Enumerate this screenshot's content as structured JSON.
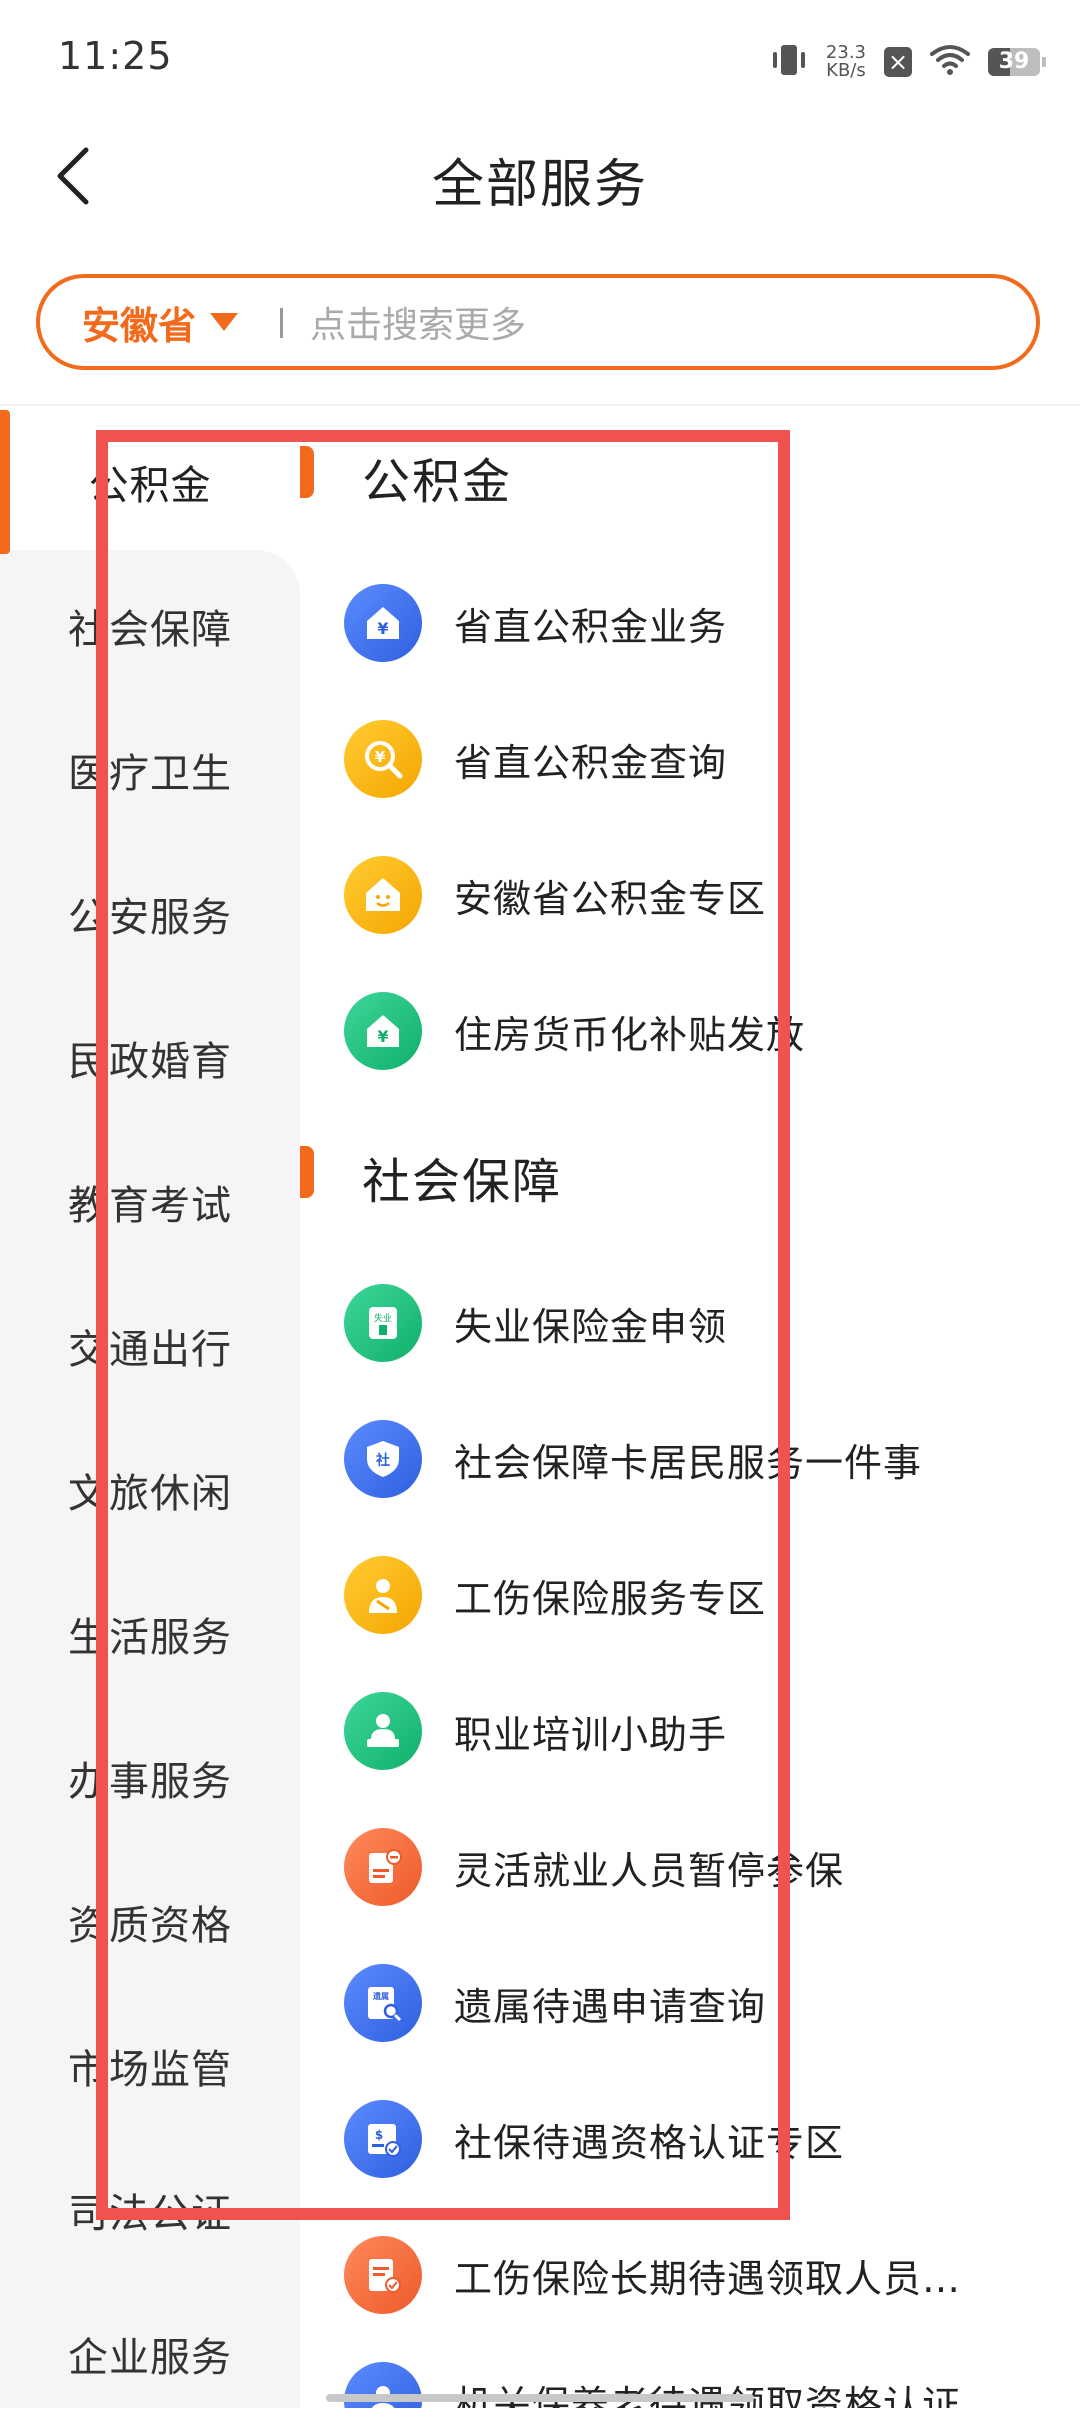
{
  "status_bar": {
    "time": "11:25",
    "net_speed_value": "23.3",
    "net_speed_unit": "KB/s",
    "battery": "39",
    "icons": [
      "vibrate-icon",
      "close-box-icon",
      "wifi-icon",
      "battery-icon"
    ]
  },
  "header": {
    "title": "全部服务"
  },
  "search": {
    "province": "安徽省",
    "placeholder": "点击搜索更多"
  },
  "sidebar": {
    "items": [
      {
        "label": "公积金",
        "active": true
      },
      {
        "label": "社会保障"
      },
      {
        "label": "医疗卫生"
      },
      {
        "label": "公安服务"
      },
      {
        "label": "民政婚育"
      },
      {
        "label": "教育考试"
      },
      {
        "label": "交通出行"
      },
      {
        "label": "文旅休闲"
      },
      {
        "label": "生活服务"
      },
      {
        "label": "办事服务"
      },
      {
        "label": "资质资格"
      },
      {
        "label": "市场监管"
      },
      {
        "label": "司法公证"
      },
      {
        "label": "企业服务"
      }
    ]
  },
  "sections": [
    {
      "title": "公积金",
      "services": [
        {
          "label": "省直公积金业务",
          "icon": "house-yen-icon",
          "color": "blue"
        },
        {
          "label": "省直公积金查询",
          "icon": "search-yen-icon",
          "color": "yellow"
        },
        {
          "label": "安徽省公积金专区",
          "icon": "smiling-house-icon",
          "color": "yellow"
        },
        {
          "label": "住房货币化补贴发放",
          "icon": "house-yen-icon",
          "color": "green"
        }
      ]
    },
    {
      "title": "社会保障",
      "services": [
        {
          "label": "失业保险金申领",
          "icon": "unemployment-icon",
          "color": "green",
          "glyph": "失业"
        },
        {
          "label": "社会保障卡居民服务一件事",
          "icon": "shield-icon",
          "color": "blue",
          "glyph": "社"
        },
        {
          "label": "工伤保险服务专区",
          "icon": "injured-person-icon",
          "color": "yellow"
        },
        {
          "label": "职业培训小助手",
          "icon": "lecturer-icon",
          "color": "green"
        },
        {
          "label": "灵活就业人员暂停参保",
          "icon": "pause-document-icon",
          "color": "orange"
        },
        {
          "label": "遗属待遇申请查询",
          "icon": "document-search-icon",
          "color": "blue",
          "glyph": "遗属"
        },
        {
          "label": "社保待遇资格认证专区",
          "icon": "verified-card-icon",
          "color": "blue"
        },
        {
          "label": "工伤保险长期待遇领取人员资…",
          "icon": "check-document-icon",
          "color": "orange"
        },
        {
          "label": "机关保养老待遇领取资格认证",
          "icon": "person-upload-icon",
          "color": "blue"
        }
      ]
    }
  ]
}
